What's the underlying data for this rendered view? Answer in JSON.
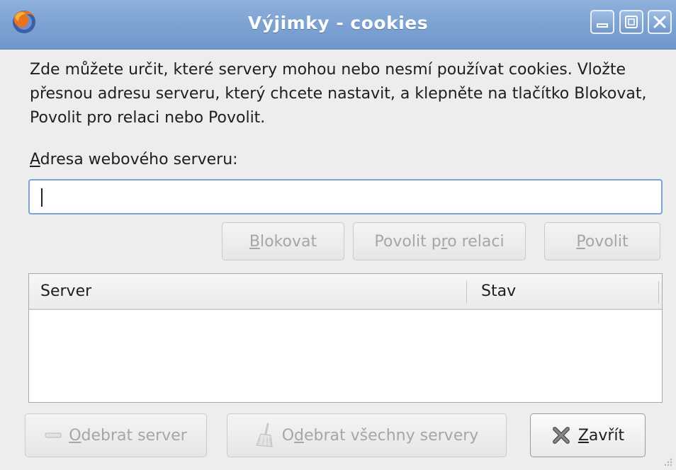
{
  "window": {
    "title": "Výjimky - cookies",
    "app_icon": "firefox-icon",
    "controls": [
      "minimize-icon",
      "maximize-icon",
      "close-icon"
    ]
  },
  "description": "Zde můžete určit, které servery mohou nebo nesmí používat cookies. Vložte přesnou adresu serveru, který chcete nastavit, a klepněte na tlačítko Blokovat, Povolit pro relaci nebo Povolit.",
  "address": {
    "label_mnemonic": "A",
    "label_rest": "dresa webového serveru:",
    "value": ""
  },
  "actions": {
    "block": {
      "mnemonic": "B",
      "rest": "lokovat"
    },
    "allow_session": {
      "pre": "Povolit p",
      "mnemonic": "r",
      "post": "o relaci"
    },
    "allow": {
      "mnemonic": "P",
      "rest": "ovolit"
    }
  },
  "list": {
    "columns": [
      "Server",
      "Stav"
    ],
    "rows": []
  },
  "footer": {
    "remove": {
      "icon": "remove-icon",
      "mnemonic": "O",
      "rest": "debrat server"
    },
    "remove_all": {
      "icon": "broom-icon",
      "pre": "O",
      "mnemonic": "d",
      "post": "ebrat všechny servery"
    },
    "close": {
      "icon": "close-x-icon",
      "mnemonic": "Z",
      "rest": "avřít"
    }
  },
  "colors": {
    "titlebar": "#7ea4d3",
    "window_bg": "#ededed",
    "input_focus_border": "#7ea2d8",
    "disabled_text": "#a6a6a6"
  }
}
